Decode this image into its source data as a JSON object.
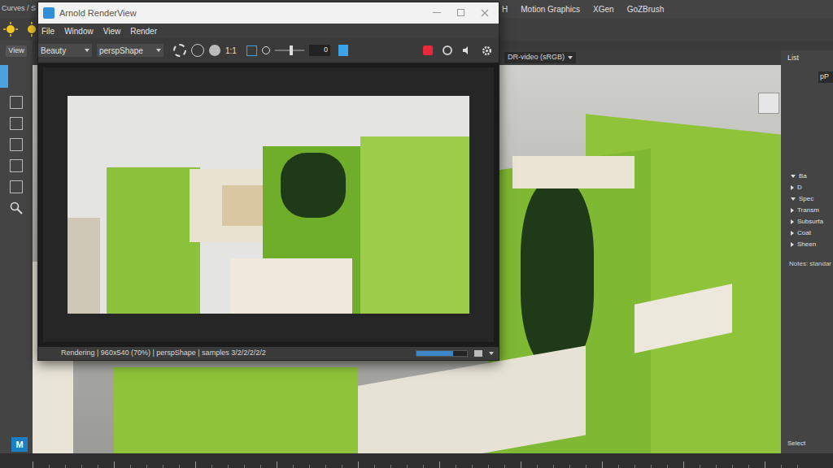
{
  "maya": {
    "shelf_label": "Curves / S",
    "shelf_tabs": [
      {
        "label": "H",
        "selected": false
      },
      {
        "label": "Motion Graphics",
        "selected": false
      },
      {
        "label": "XGen",
        "selected": false
      },
      {
        "label": "GoZBrush",
        "selected": false
      }
    ],
    "view_tab": "View",
    "logo": "M",
    "viewport": {
      "color_space": "DR-video (sRGB)"
    },
    "attribute_panel": {
      "header": "List",
      "node": "pP",
      "sections": [
        {
          "label": "Ba",
          "expanded": true
        },
        {
          "label": "D",
          "expanded": false
        },
        {
          "label": "Spec",
          "expanded": true
        },
        {
          "label": "Transm",
          "expanded": false
        },
        {
          "label": "Subsurfa",
          "expanded": false
        },
        {
          "label": "Coat",
          "expanded": false
        },
        {
          "label": "Sheen",
          "expanded": false
        }
      ],
      "notes": "Notes: standar",
      "select_button": "Select"
    }
  },
  "render_view": {
    "title": "Arnold RenderView",
    "menu": [
      "File",
      "Window",
      "View",
      "Render"
    ],
    "aov": "Beauty",
    "camera": "perspShape",
    "ratio": "1:1",
    "exposure": "0",
    "exposure_level": 0.55,
    "rendering": true,
    "status": "Rendering | 960x540 (70%) | perspShape | samples 3/2/2/2/2/2",
    "progress": 0.72
  }
}
